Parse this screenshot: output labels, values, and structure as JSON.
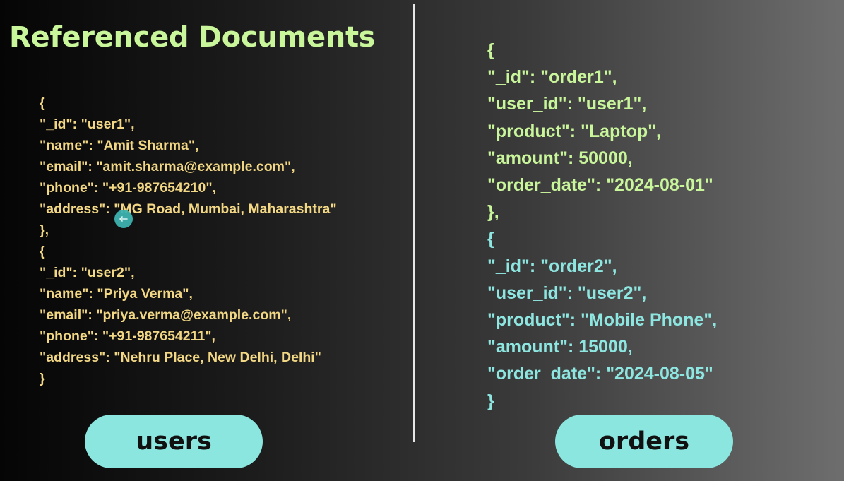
{
  "title": "Referenced Documents",
  "users": {
    "label": "users",
    "lines": [
      "{",
      "\"_id\": \"user1\",",
      "\"name\": \"Amit Sharma\",",
      "\"email\": \"amit.sharma@example.com\",",
      "\"phone\": \"+91-987654210\",",
      "\"address\": \"MG Road, Mumbai, Maharashtra\"",
      "},",
      "{",
      "\"_id\": \"user2\",",
      "\"name\": \"Priya Verma\",",
      "\"email\": \"priya.verma@example.com\",",
      "\"phone\": \"+91-987654211\",",
      "\"address\": \"Nehru Place, New Delhi, Delhi\"",
      "}"
    ]
  },
  "orders": {
    "label": "orders",
    "lines": [
      "{",
      "\"_id\": \"order1\",",
      "\"user_id\": \"user1\",",
      "\"product\": \"Laptop\",",
      "\"amount\": 50000,",
      "\"order_date\": \"2024-08-01\"",
      "},",
      "{",
      "\"_id\": \"order2\",",
      "\"user_id\": \"user2\",",
      "\"product\": \"Mobile Phone\",",
      "\"amount\": 15000,",
      "\"order_date\": \"2024-08-05\"",
      "}"
    ]
  },
  "colors": {
    "title": "#c9f59b",
    "users_code": "#f2d784",
    "orders_first_doc": "#c9f59b",
    "orders_second_doc": "#8ee6e1",
    "pill": "#8ae6df",
    "cursor": "#3eb3b0"
  },
  "cursor_icon": "move-cursor-icon"
}
